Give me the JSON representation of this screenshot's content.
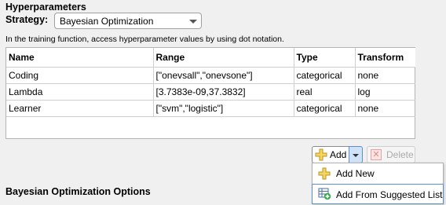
{
  "hyperparameters": {
    "title": "Hyperparameters",
    "strategy_label": "Strategy:",
    "strategy_value": "Bayesian Optimization",
    "hint": "In the training function, access hyperparameter values by using dot notation."
  },
  "table": {
    "columns": [
      "Name",
      "Range",
      "Type",
      "Transform"
    ],
    "rows": [
      [
        "Coding",
        "[\"onevsall\",\"onevsone\"]",
        "categorical",
        "none"
      ],
      [
        "Lambda",
        "[3.7383e-09,37.3832]",
        "real",
        "log"
      ],
      [
        "Learner",
        "[\"svm\",\"logistic\"]",
        "categorical",
        "none"
      ]
    ]
  },
  "toolbar": {
    "add_label": "Add",
    "delete_label": "Delete",
    "add_icon": "plus-icon",
    "delete_icon": "x-icon"
  },
  "add_menu": {
    "items": [
      {
        "label": "Add New",
        "icon": "plus-icon"
      },
      {
        "label": "Add From Suggested List",
        "icon": "table-add-icon"
      }
    ]
  },
  "bayes_section": {
    "title": "Bayesian Optimization Options"
  },
  "colors": {
    "background": "#f0f0f0",
    "accent_blue": "#5a8fd0",
    "plus_yellow": "#f6d55c",
    "delete_red": "#e8a0a0"
  }
}
